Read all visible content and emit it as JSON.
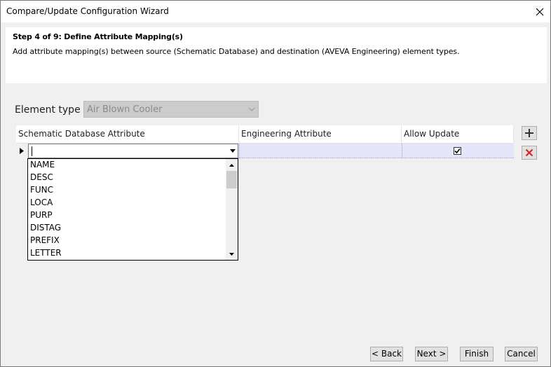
{
  "window": {
    "title": "Compare/Update Configuration Wizard"
  },
  "header": {
    "step_title": "Step 4 of 9: Define Attribute Mapping(s)",
    "step_desc": "Add attribute mapping(s) between source (Schematic Database) and destination (AVEVA Engineering) element types."
  },
  "element_type": {
    "label": "Element type",
    "value": "Air Blown Cooler"
  },
  "grid": {
    "columns": [
      "Schematic Database Attribute",
      "Engineering Attribute",
      "Allow Update"
    ],
    "row": {
      "schematic_value": "",
      "engineering_value": "",
      "allow_update": true
    }
  },
  "dropdown": {
    "options": [
      "NAME",
      "DESC",
      "FUNC",
      "LOCA",
      "PURP",
      "DISTAG",
      "PREFIX",
      "LETTER"
    ]
  },
  "icons": {
    "close": "close-icon",
    "add": "plus-icon",
    "delete": "delete-x-icon",
    "row_pointer": "row-pointer-icon"
  },
  "colors": {
    "row_selected": "#e6e6fa",
    "delete_red": "#d81e1e",
    "disabled_combo": "#cccccc"
  },
  "buttons": {
    "back": "< Back",
    "next": "Next >",
    "finish": "Finish",
    "cancel": "Cancel"
  }
}
